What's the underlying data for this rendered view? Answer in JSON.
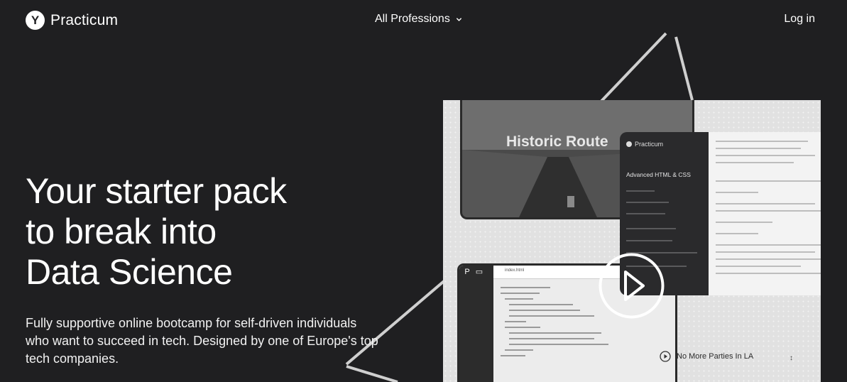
{
  "header": {
    "logo_glyph": "Y",
    "logo_text": "Practicum",
    "nav_label": "All Professions",
    "login_label": "Log in"
  },
  "hero": {
    "title_lines": [
      "Your starter pack",
      "to break into",
      "Data Science"
    ],
    "subtitle": "Fully supportive online bootcamp for self-driven individuals who want to succeed in tech. Designed by one of Europe's top tech companies."
  },
  "media": {
    "video_title": "Historic Route",
    "course_brand": "Practicum",
    "course_title": "Advanced HTML & CSS",
    "code_tab": "index.html",
    "track_title": "No More Parties In LA",
    "track_menu": "↕"
  },
  "colors": {
    "background": "#1f1f21",
    "text": "#ffffff",
    "media_bg": "#e1e1e1",
    "panel_dark": "#2a2a2c"
  },
  "icons": {
    "logo": "practicum-logo-icon",
    "nav_chevron": "chevron-down-icon",
    "play": "play-circle-icon",
    "track_play": "play-small-icon"
  }
}
